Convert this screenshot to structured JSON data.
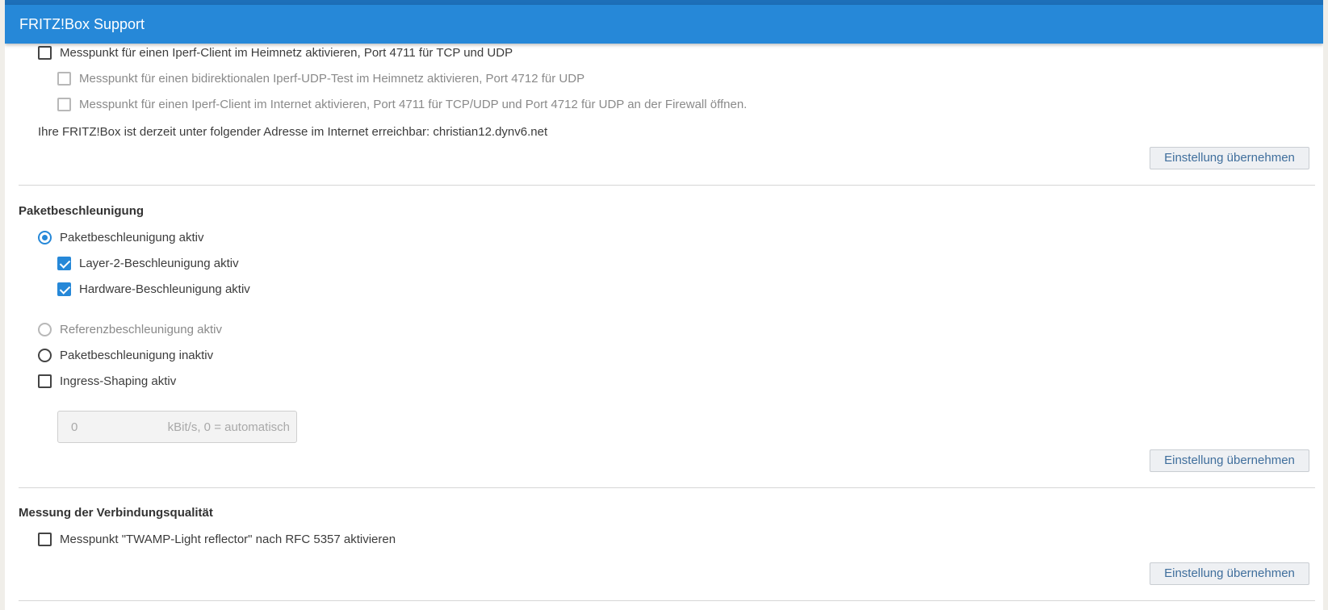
{
  "window": {
    "title": "FRITZ!Box Support"
  },
  "iperf": {
    "items": [
      {
        "label": "Messpunkt für einen Iperf-Client im Heimnetz aktivieren, Port 4711 für TCP und UDP",
        "checked": false,
        "disabled": false
      },
      {
        "label": "Messpunkt für einen bidirektionalen Iperf-UDP-Test im Heimnetz aktivieren, Port 4712 für UDP",
        "checked": false,
        "disabled": true
      },
      {
        "label": "Messpunkt für einen Iperf-Client im Internet aktivieren, Port 4711 für TCP/UDP und Port 4712 für UDP an der Firewall öffnen.",
        "checked": false,
        "disabled": true
      }
    ],
    "address_text": "Ihre FRITZ!Box ist derzeit unter folgender Adresse im Internet erreichbar: christian12.dynv6.net",
    "apply_label": "Einstellung übernehmen"
  },
  "acceleration": {
    "heading": "Paketbeschleunigung",
    "active_label": "Paketbeschleunigung aktiv",
    "layer2_label": "Layer-2-Beschleunigung aktiv",
    "hardware_label": "Hardware-Beschleunigung aktiv",
    "reference_label": "Referenzbeschleunigung aktiv",
    "inactive_label": "Paketbeschleunigung inaktiv",
    "ingress_label": "Ingress-Shaping aktiv",
    "ingress_value": "0",
    "ingress_unit": "kBit/s, 0 = automatisch",
    "apply_label": "Einstellung übernehmen"
  },
  "quality": {
    "heading": "Messung der Verbindungsqualität",
    "twamp_label": "Messpunkt \"TWAMP-Light reflector\" nach RFC 5357 aktivieren",
    "apply_label": "Einstellung übernehmen"
  },
  "colors": {
    "titlebar": "#2688d8",
    "accent": "#2688d8"
  }
}
